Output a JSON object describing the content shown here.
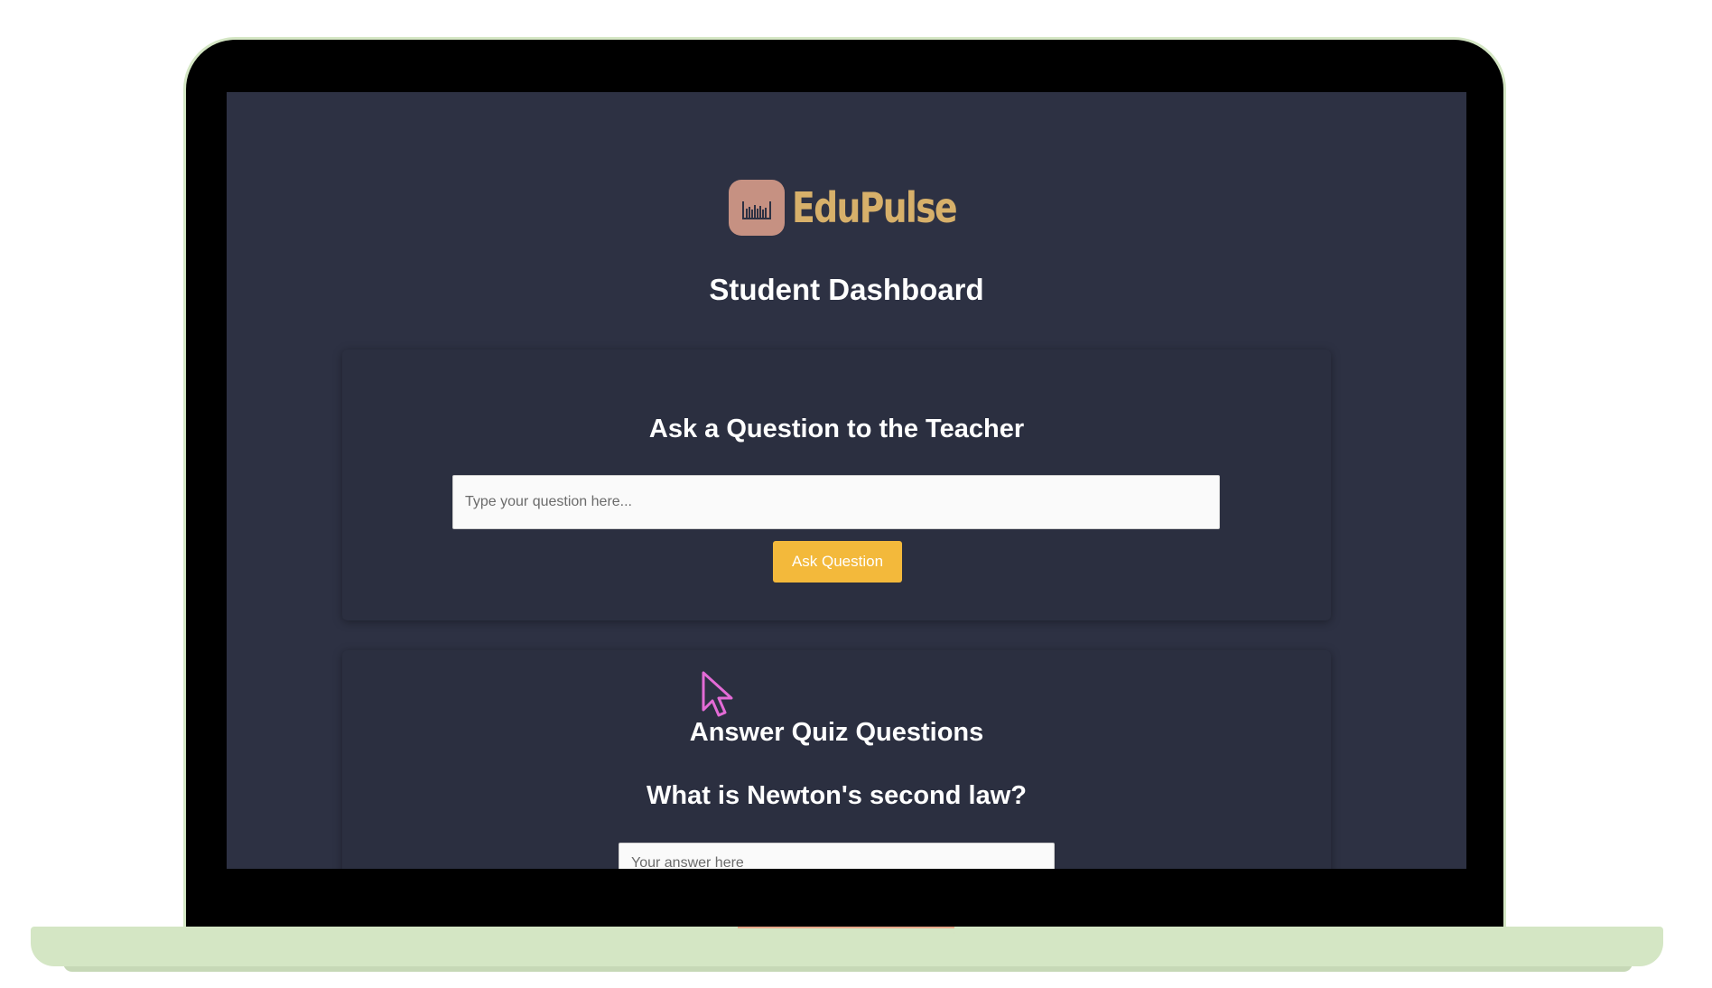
{
  "app": {
    "logo_text": "EduPulse",
    "page_title": "Student Dashboard"
  },
  "ask_section": {
    "title": "Ask a Question to the Teacher",
    "input_placeholder": "Type your question here...",
    "input_value": "",
    "button_label": "Ask Question"
  },
  "quiz_section": {
    "title": "Answer Quiz Questions",
    "question": "What is Newton's second law?",
    "answer_placeholder": "Your answer here",
    "answer_value": ""
  },
  "icons": {
    "logo": "bar-chart-icon",
    "cursor": "mouse-pointer-icon"
  },
  "colors": {
    "background": "#2d3143",
    "accent": "#f3b93b",
    "logo_text": "#d7b06a",
    "logo_mark": "#c69182",
    "laptop_body": "#d4e6c4"
  }
}
